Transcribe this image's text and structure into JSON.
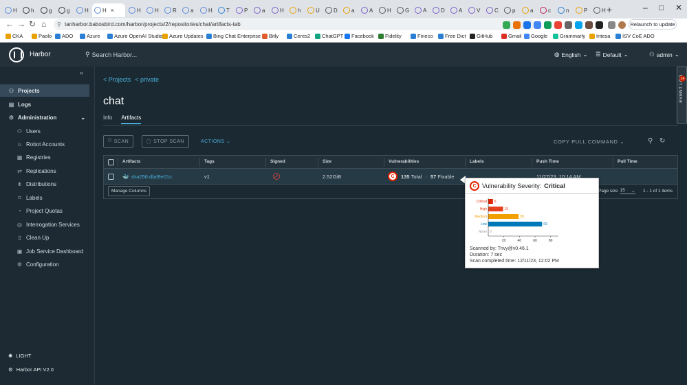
{
  "browser": {
    "tabs": [
      {
        "letter": "H",
        "color": "#5d8ad6"
      },
      {
        "letter": "h",
        "color": "#333333"
      },
      {
        "letter": "g",
        "color": "#333333"
      },
      {
        "letter": "g",
        "color": "#333333"
      },
      {
        "letter": "H",
        "color": "#5d8ad6"
      },
      {
        "letter": "H",
        "color": "#5d8ad6",
        "active": true
      },
      {
        "letter": "H",
        "color": "#5d8ad6"
      },
      {
        "letter": "H",
        "color": "#5d8ad6"
      },
      {
        "letter": "R",
        "color": "#5d8ad6"
      },
      {
        "letter": "a",
        "color": "#5d8ad6"
      },
      {
        "letter": "H",
        "color": "#5d8ad6"
      },
      {
        "letter": "T",
        "color": "#2a7fd4"
      },
      {
        "letter": "P",
        "color": "#7c5cc4"
      },
      {
        "letter": "a",
        "color": "#7c5cc4"
      },
      {
        "letter": "H",
        "color": "#7c5cc4"
      },
      {
        "letter": "h",
        "color": "#e8a100"
      },
      {
        "letter": "U",
        "color": "#e8a100"
      },
      {
        "letter": "D",
        "color": "#555555"
      },
      {
        "letter": "a",
        "color": "#e8a100"
      },
      {
        "letter": "A",
        "color": "#7c5cc4"
      },
      {
        "letter": "H",
        "color": "#555555"
      },
      {
        "letter": "G",
        "color": "#555555"
      },
      {
        "letter": "A",
        "color": "#7c5cc4"
      },
      {
        "letter": "D",
        "color": "#7c5cc4"
      },
      {
        "letter": "A",
        "color": "#7c5cc4"
      },
      {
        "letter": "V",
        "color": "#7c5cc4"
      },
      {
        "letter": "C",
        "color": "#7c5cc4"
      },
      {
        "letter": "p",
        "color": "#555555"
      },
      {
        "letter": "a",
        "color": "#e8a100"
      },
      {
        "letter": "c",
        "color": "#c2185b"
      },
      {
        "letter": "n",
        "color": "#2a7fd4"
      },
      {
        "letter": "P",
        "color": "#e8a100"
      },
      {
        "letter": "H",
        "color": "#555555"
      }
    ],
    "active_tab_close": "×",
    "new_tab": "+",
    "window_controls": {
      "minimize": "–",
      "maximize": "□",
      "close": "✕"
    },
    "url": "tanharbor.babosbird.com/harbor/projects/2/repositories/chat/artifacts-tab",
    "relaunch_label": "Relaunch to update",
    "bookmarks": [
      "CKA",
      "Paolo",
      "ADO",
      "Azure",
      "Azure OpenAI Studio",
      "Azure Updates",
      "Bing Chat Enterprise",
      "Bitly",
      "Ceres2",
      "ChatGPT",
      "Facebook",
      "Fidelity",
      "Fineco",
      "Free Dict",
      "GitHub",
      "Gmail",
      "Google",
      "Grammarly",
      "Intesa",
      "ISV CoE ADO"
    ],
    "bookmark_colors": [
      "#e8a100",
      "#e8a100",
      "#2a7fd4",
      "#2a7fd4",
      "#2a7fd4",
      "#e8a100",
      "#2a7fd4",
      "#e05d2b",
      "#2a7fd4",
      "#10a37f",
      "#1877f2",
      "#2e7d32",
      "#2a7fd4",
      "#2a7fd4",
      "#222222",
      "#d93025",
      "#4285f4",
      "#15c39a",
      "#e8a100",
      "#2a7fd4"
    ]
  },
  "header": {
    "app_name": "Harbor",
    "search_placeholder": "Search Harbor...",
    "language": "English",
    "theme": "Default",
    "user": "admin"
  },
  "sidebar": {
    "items": [
      {
        "label": "Projects",
        "icon": "projects-icon",
        "glyph": "⚇",
        "level": 0,
        "active": true
      },
      {
        "label": "Logs",
        "icon": "logs-icon",
        "glyph": "▤",
        "level": 0
      },
      {
        "label": "Administration",
        "icon": "administration-icon",
        "glyph": "⚙",
        "level": 0,
        "expanded": true
      },
      {
        "label": "Users",
        "icon": "users-icon",
        "glyph": "⚇",
        "level": 1
      },
      {
        "label": "Robot Accounts",
        "icon": "robot-icon",
        "glyph": "☺",
        "level": 1
      },
      {
        "label": "Registries",
        "icon": "registries-icon",
        "glyph": "▦",
        "level": 1
      },
      {
        "label": "Replications",
        "icon": "replications-icon",
        "glyph": "⇄",
        "level": 1
      },
      {
        "label": "Distributions",
        "icon": "distributions-icon",
        "glyph": "⋔",
        "level": 1
      },
      {
        "label": "Labels",
        "icon": "labels-icon",
        "glyph": "⌑",
        "level": 1
      },
      {
        "label": "Project Quotas",
        "icon": "quotas-icon",
        "glyph": "◔",
        "level": 1
      },
      {
        "label": "Interrogation Services",
        "icon": "interrogation-icon",
        "glyph": "◎",
        "level": 1
      },
      {
        "label": "Clean Up",
        "icon": "cleanup-icon",
        "glyph": "▯",
        "level": 1
      },
      {
        "label": "Job Service Dashboard",
        "icon": "job-dashboard-icon",
        "glyph": "▣",
        "level": 1
      },
      {
        "label": "Configuration",
        "icon": "configuration-icon",
        "glyph": "⚙",
        "level": 1
      }
    ],
    "theme_toggle": "LIGHT",
    "api_link": "Harbor API V2.0"
  },
  "main": {
    "breadcrumb": [
      "< Projects",
      "< private"
    ],
    "title": "chat",
    "tabs": [
      {
        "label": "Info"
      },
      {
        "label": "Artifacts",
        "active": true
      }
    ],
    "toolbar": {
      "scan": "SCAN",
      "stop_scan": "STOP SCAN",
      "actions": "ACTIONS",
      "copy_pull": "COPY PULL COMMAND"
    },
    "table": {
      "columns": [
        "Artifacts",
        "Tags",
        "Signed",
        "Size",
        "Vulnerabilities",
        "Labels",
        "Push Time",
        "Pull Time"
      ],
      "rows": [
        {
          "artifact": "sha256:dbd9e01c",
          "tags": "v1",
          "size": "2.52GiB",
          "vuln_total": "135",
          "vuln_total_label": "Total",
          "vuln_fixable": "57",
          "vuln_fixable_label": "Fixable",
          "vuln_badge": "C",
          "push_time": "11/27/23, 10:14 AM",
          "pull_time": ""
        }
      ],
      "manage_columns": "Manage Columns",
      "page_size_label": "Page size",
      "page_size": "15",
      "items_count": "1 - 1 of 1 items"
    }
  },
  "popover": {
    "badge": "C",
    "title": "Vulnerability Severity:",
    "severity": "Critical",
    "scanned_by": "Scanned by:  Trivy@v0.46.1",
    "duration": "Duration:  7 sec",
    "completed": "Scan completed time: 12/11/23, 12:02 PM"
  },
  "chart_data": {
    "type": "bar",
    "orientation": "horizontal",
    "categories": [
      "Critical",
      "High",
      "Medium",
      "Low",
      "None"
    ],
    "values": [
      6,
      19,
      39,
      69,
      0
    ],
    "colors": [
      "#e12200",
      "#e5411e",
      "#f29f00",
      "#0079b8",
      "#999999"
    ],
    "xticks": [
      20,
      40,
      60,
      80
    ],
    "xlim": [
      0,
      90
    ]
  },
  "event_log": {
    "label": "EVENT LOG",
    "count": "14"
  },
  "colors": {
    "accent": "#4aaed9",
    "critical": "#e12200",
    "header_bg": "#25313a",
    "page_bg": "#1b2a32"
  }
}
